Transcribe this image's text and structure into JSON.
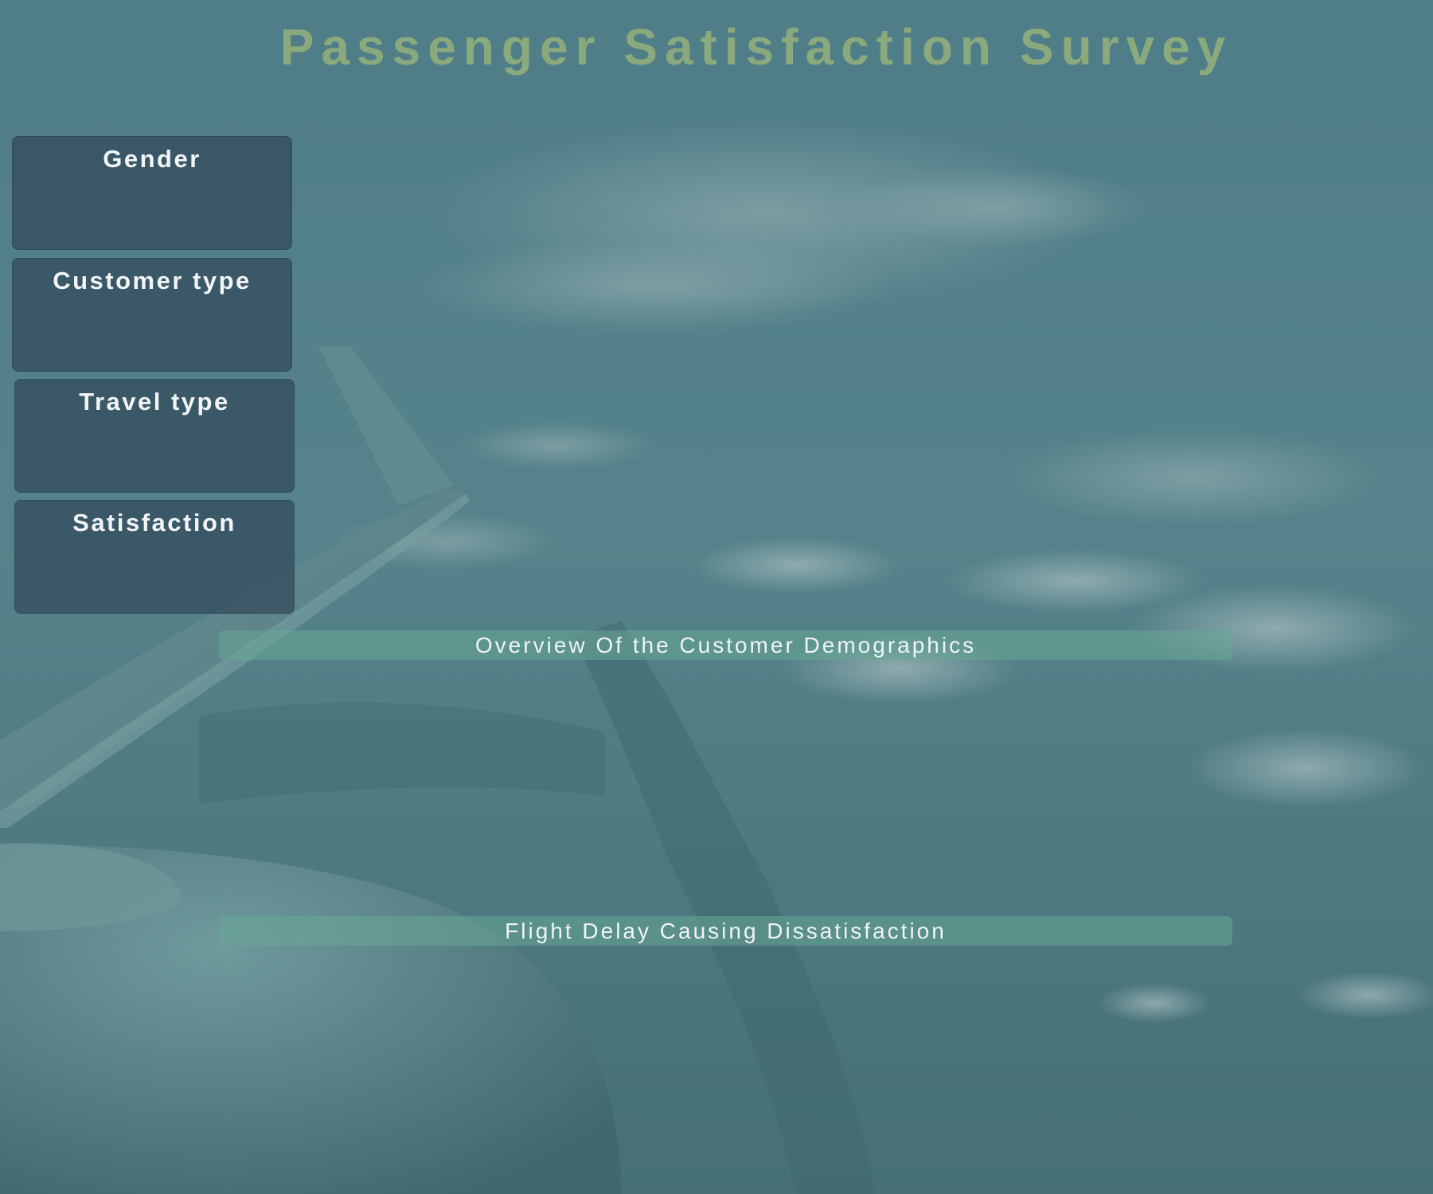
{
  "page": {
    "title": "Passenger Satisfaction Survey",
    "background_icon": "airplane-wing-sky-photo"
  },
  "filters": [
    {
      "label": "Gender"
    },
    {
      "label": "Customer type"
    },
    {
      "label": "Travel type"
    },
    {
      "label": "Satisfaction"
    }
  ],
  "sections": {
    "demographics": {
      "label": "Overview Of the Customer Demographics"
    },
    "delay": {
      "label": "Flight Delay Causing Dissatisfaction"
    }
  },
  "colors": {
    "title": "#8aa97c",
    "background": "#4a7780",
    "panel": "#30485a",
    "section_bar": "#68a896",
    "text_light": "#f2f4f5"
  }
}
